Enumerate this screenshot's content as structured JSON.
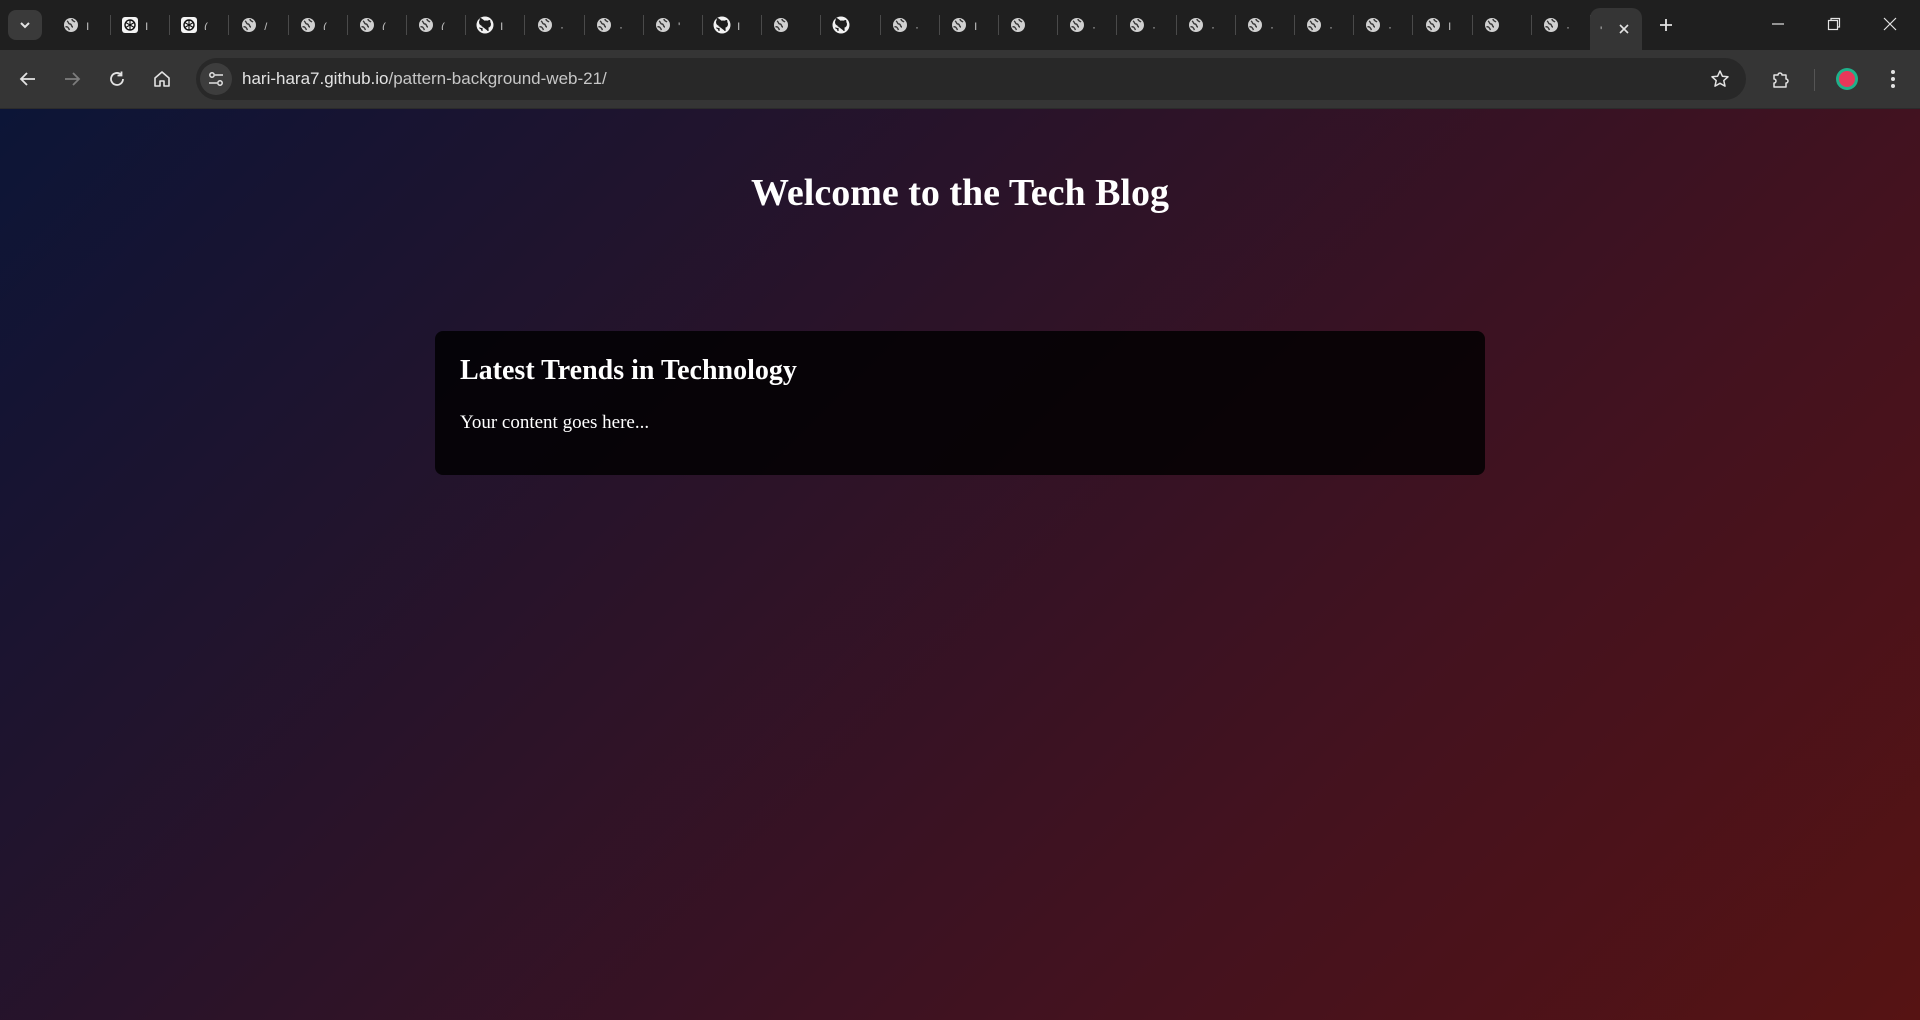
{
  "browser": {
    "address": {
      "host": "hari-hara7.github.io",
      "path": "/pattern-background-web-21/"
    },
    "tabs": [
      {
        "icon": "globe-icon",
        "title": "I"
      },
      {
        "icon": "chatgpt-icon",
        "title": "I"
      },
      {
        "icon": "chatgpt-icon",
        "title": "("
      },
      {
        "icon": "globe-icon",
        "title": "/"
      },
      {
        "icon": "globe-icon",
        "title": "("
      },
      {
        "icon": "globe-icon",
        "title": "("
      },
      {
        "icon": "globe-icon",
        "title": "("
      },
      {
        "icon": "github-icon",
        "title": "I"
      },
      {
        "icon": "globe-icon",
        "title": "·"
      },
      {
        "icon": "globe-icon",
        "title": "·"
      },
      {
        "icon": "globe-icon",
        "title": "'"
      },
      {
        "icon": "github-icon",
        "title": "I"
      },
      {
        "icon": "globe-icon",
        "title": ""
      },
      {
        "icon": "github-icon",
        "title": ""
      },
      {
        "icon": "globe-icon",
        "title": "·"
      },
      {
        "icon": "globe-icon",
        "title": "I"
      },
      {
        "icon": "globe-icon",
        "title": ""
      },
      {
        "icon": "globe-icon",
        "title": "·"
      },
      {
        "icon": "globe-icon",
        "title": "·"
      },
      {
        "icon": "globe-icon",
        "title": "·"
      },
      {
        "icon": "globe-icon",
        "title": "·"
      },
      {
        "icon": "globe-icon",
        "title": "·"
      },
      {
        "icon": "globe-icon",
        "title": "·"
      },
      {
        "icon": "globe-icon",
        "title": "I"
      },
      {
        "icon": "globe-icon",
        "title": ""
      },
      {
        "icon": "globe-icon",
        "title": "·"
      }
    ],
    "active_tab": {
      "title": "'"
    },
    "profile_color": "#e8375a",
    "accent_ring": "#1fb08a"
  },
  "page": {
    "heading": "Welcome to the Tech Blog",
    "card": {
      "title": "Latest Trends in Technology",
      "body": "Your content goes here..."
    },
    "gradient": {
      "start": "#0c1537",
      "end": "#561313"
    }
  }
}
